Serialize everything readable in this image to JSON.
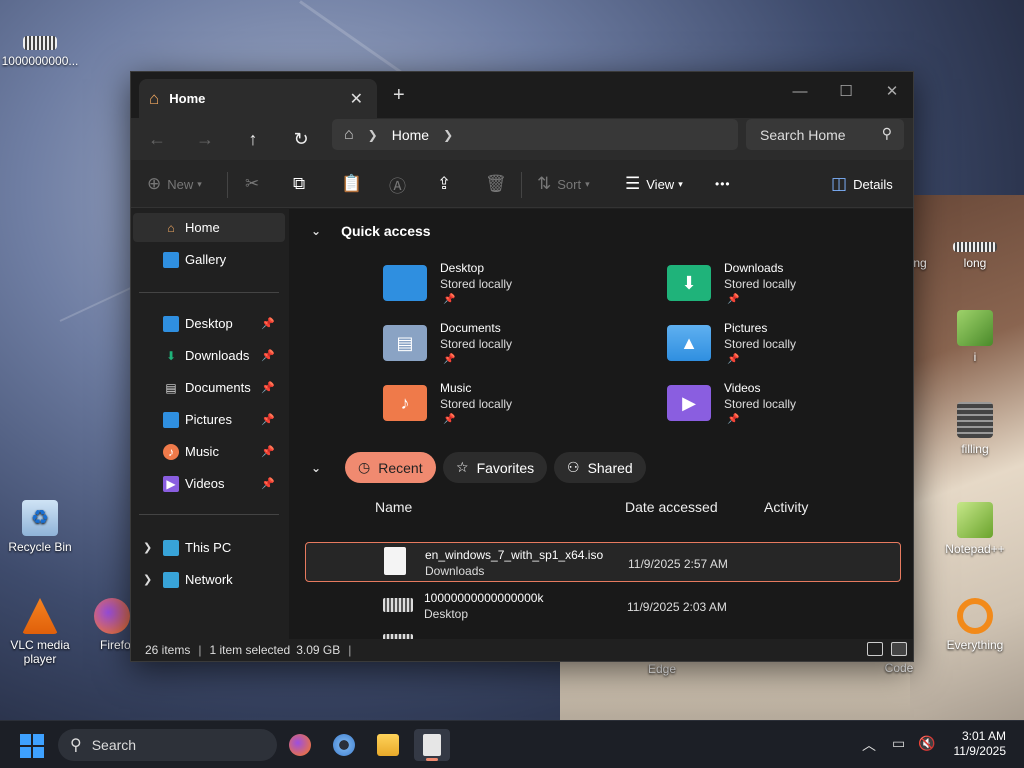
{
  "desktop": {
    "icons": [
      {
        "label": "1000000000..."
      },
      {
        "label": "Recycle Bin"
      },
      {
        "label": "VLC media player"
      },
      {
        "label": "Firefo"
      },
      {
        "label": "long"
      },
      {
        "label": "i"
      },
      {
        "label": "filling"
      },
      {
        "label": "Notepad++"
      },
      {
        "label": "Everything"
      },
      {
        "label": "Edge"
      },
      {
        "label": "udio Code"
      },
      {
        "label": "ng"
      }
    ]
  },
  "window": {
    "tab_title": "Home",
    "close_tab": "✕",
    "new_tab": "+",
    "address": {
      "crumb": "Home"
    },
    "search": {
      "placeholder": "Search Home"
    },
    "toolbar": {
      "new_label": "New",
      "sort_label": "Sort",
      "view_label": "View",
      "more_label": "•••",
      "details_label": "Details"
    },
    "nav": {
      "top": [
        {
          "label": "Home"
        },
        {
          "label": "Gallery"
        }
      ],
      "pinned": [
        {
          "label": "Desktop"
        },
        {
          "label": "Downloads"
        },
        {
          "label": "Documents"
        },
        {
          "label": "Pictures"
        },
        {
          "label": "Music"
        },
        {
          "label": "Videos"
        }
      ],
      "bottom": [
        {
          "label": "This PC"
        },
        {
          "label": "Network"
        }
      ]
    },
    "quick_access": {
      "title": "Quick access",
      "items": [
        {
          "name": "Desktop",
          "sub": "Stored locally",
          "color": "#2f8fe0"
        },
        {
          "name": "Downloads",
          "sub": "Stored locally",
          "color": "#1fb37a"
        },
        {
          "name": "Documents",
          "sub": "Stored locally",
          "color": "#8aa3c4"
        },
        {
          "name": "Pictures",
          "sub": "Stored locally",
          "color": "#2f8fe0"
        },
        {
          "name": "Music",
          "sub": "Stored locally",
          "color": "#ef7a4a"
        },
        {
          "name": "Videos",
          "sub": "Stored locally",
          "color": "#8a5ee0"
        }
      ]
    },
    "recent": {
      "tabs": [
        {
          "label": "Recent"
        },
        {
          "label": "Favorites"
        },
        {
          "label": "Shared"
        }
      ],
      "columns": {
        "name": "Name",
        "date": "Date accessed",
        "activity": "Activity"
      },
      "files": [
        {
          "name": "en_windows_7_with_sp1_x64.iso",
          "location": "Downloads",
          "date": "11/9/2025 2:57 AM"
        },
        {
          "name": "10000000000000000k",
          "location": "Desktop",
          "date": "11/9/2025 2:03 AM"
        }
      ]
    },
    "status": {
      "items": "26 items",
      "selected": "1 item selected",
      "size": "3.09 GB"
    }
  },
  "taskbar": {
    "search_label": "Search",
    "time": "3:01 AM",
    "date": "11/9/2025"
  },
  "colors": {
    "accent": "#f08a70",
    "selection_border": "#e77a5f"
  }
}
